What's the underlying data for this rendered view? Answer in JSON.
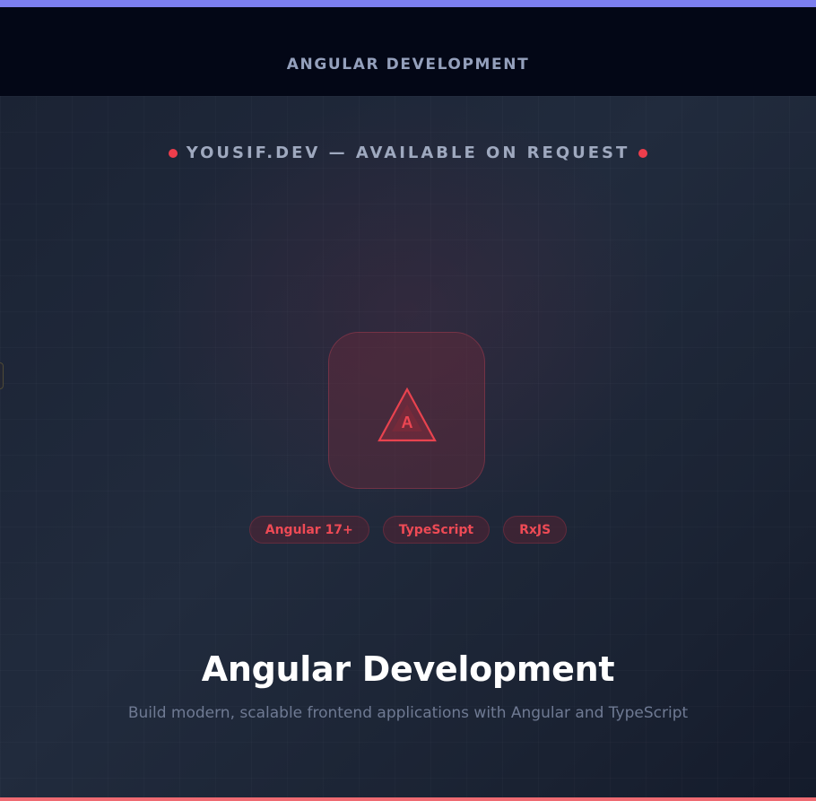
{
  "header": {
    "title": "ANGULAR DEVELOPMENT"
  },
  "hero": {
    "badge": "YOUSIF.DEV — AVAILABLE ON REQUEST",
    "logo": {
      "icon": "angular-logo-icon",
      "letter": "A"
    },
    "tags": [
      "Angular 17+",
      "TypeScript",
      "RxJS"
    ],
    "title": "Angular Development",
    "subtitle": "Build modern, scalable frontend applications with Angular and TypeScript"
  },
  "colors": {
    "accent_top": "#7c7ff0",
    "accent_bottom": "#ef6a72",
    "brand_red": "#ee3e4c",
    "header_bg": "#030716",
    "hero_bg": "#1e2738"
  }
}
